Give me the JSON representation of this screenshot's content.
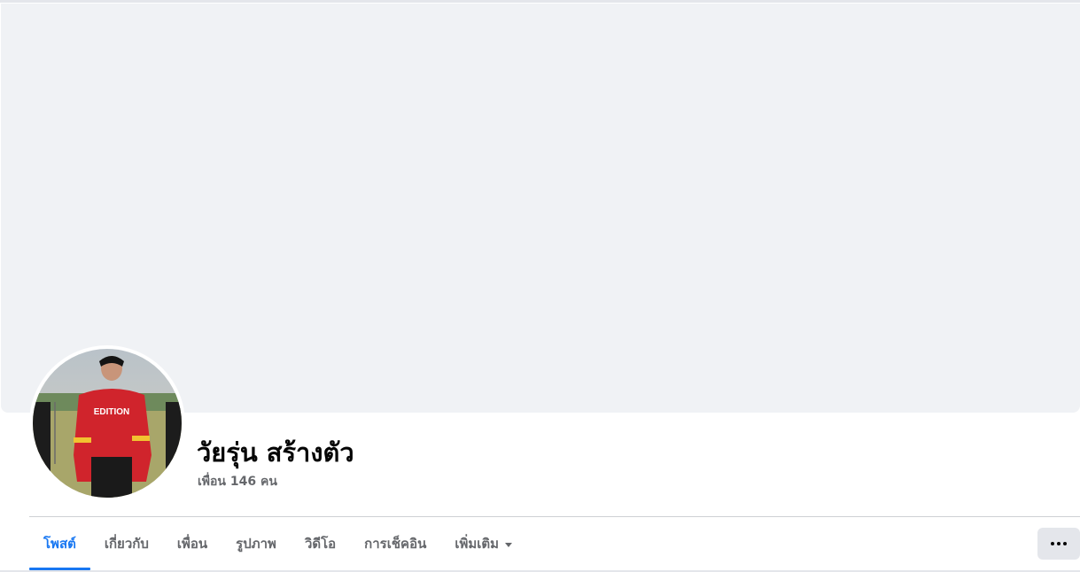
{
  "profile": {
    "name": "วัยรุ่น สร้างตัว",
    "friends": "เพื่อน 146 คน",
    "avatar_icon": "profile-photo-person-red-sweater",
    "shirt_text": "EDITION"
  },
  "tabs": [
    {
      "label": "โพสต์",
      "active": true
    },
    {
      "label": "เกี่ยวกับ",
      "active": false
    },
    {
      "label": "เพื่อน",
      "active": false
    },
    {
      "label": "รูปภาพ",
      "active": false
    },
    {
      "label": "วิดีโอ",
      "active": false
    },
    {
      "label": "การเช็คอิน",
      "active": false
    },
    {
      "label": "เพิ่มเติม",
      "active": false,
      "icon": "caret-down-icon"
    }
  ],
  "more_button": {
    "icon": "more-horizontal-icon"
  },
  "colors": {
    "accent": "#1877f2",
    "cover": "#f0f2f5",
    "secondary_text": "#65676b"
  }
}
